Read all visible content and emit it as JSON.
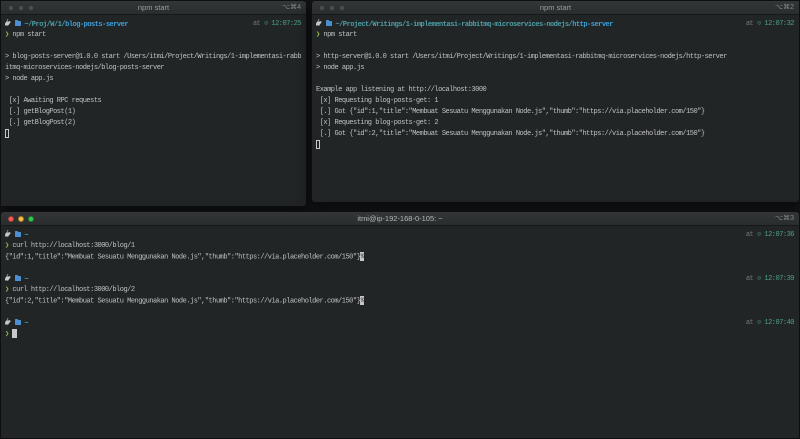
{
  "ui": {
    "at_label": "at ",
    "clock_glyph": "⊙ ",
    "colors": {
      "terminal_bg": "#222526",
      "accent_green": "#97bf4e",
      "accent_cyan": "#4d9fa8",
      "accent_blue": "#3ca0d9",
      "time_teal": "#4ba188",
      "traffic_red": "#fc5b57",
      "traffic_yellow": "#fdbe41",
      "traffic_green": "#34c84a",
      "traffic_inactive": "#4c4f50"
    }
  },
  "windows": {
    "top_left": {
      "title": "npm start",
      "shortcut": "⌥⌘4",
      "active": false,
      "lines": [
        {
          "p": {
            "path": "~/Proj/W/1/",
            "dir": "blog-posts-server",
            "time": "12:07:25"
          }
        },
        {
          "s": [
            {
              "t": "❯",
              "c": "grn"
            },
            {
              "t": " npm start",
              "c": "fg"
            }
          ]
        },
        {
          "s": []
        },
        {
          "s": [
            {
              "t": "> blog-posts-server@1.0.0 start /Users/itmi/Project/Writings/1-implementasi-rabb",
              "c": "fg"
            }
          ]
        },
        {
          "s": [
            {
              "t": "itmq-microservices-nodejs/blog-posts-server",
              "c": "fg"
            }
          ]
        },
        {
          "s": [
            {
              "t": "> node app.js",
              "c": "fg"
            }
          ]
        },
        {
          "s": []
        },
        {
          "s": [
            {
              "t": " [x] Awaiting RPC requests",
              "c": "fg"
            }
          ]
        },
        {
          "s": [
            {
              "t": " [.] getBlogPost(1)",
              "c": "fg"
            }
          ]
        },
        {
          "s": [
            {
              "t": " [.] getBlogPost(2)",
              "c": "fg"
            }
          ]
        },
        {
          "s": [
            {
              "c": "cur_h"
            }
          ]
        }
      ]
    },
    "top_right": {
      "title": "npm start",
      "shortcut": "⌥⌘2",
      "active": false,
      "lines": [
        {
          "p": {
            "path": "~/Project/Writings/1-implementasi-rabbitmq-microservices-nodejs/",
            "dir": "http-server",
            "time": "12:07:32"
          }
        },
        {
          "s": [
            {
              "t": "❯",
              "c": "grn"
            },
            {
              "t": " npm start",
              "c": "fg"
            }
          ]
        },
        {
          "s": []
        },
        {
          "s": [
            {
              "t": "> http-server@1.0.0 start /Users/itmi/Project/Writings/1-implementasi-rabbitmq-microservices-nodejs/http-server",
              "c": "fg"
            }
          ]
        },
        {
          "s": [
            {
              "t": "> node app.js",
              "c": "fg"
            }
          ]
        },
        {
          "s": []
        },
        {
          "s": [
            {
              "t": "Example app listening at http://localhost:3000",
              "c": "fg"
            }
          ]
        },
        {
          "s": [
            {
              "t": " [x] Requesting blog-posts-get: 1",
              "c": "fg"
            }
          ]
        },
        {
          "s": [
            {
              "t": " [.] Got {\"id\":1,\"title\":\"Membuat Sesuatu Menggunakan Node.js\",\"thumb\":\"https://via.placeholder.com/150\"}",
              "c": "fg"
            }
          ]
        },
        {
          "s": [
            {
              "t": " [x] Requesting blog-posts-get: 2",
              "c": "fg"
            }
          ]
        },
        {
          "s": [
            {
              "t": " [.] Got {\"id\":2,\"title\":\"Membuat Sesuatu Menggunakan Node.js\",\"thumb\":\"https://via.placeholder.com/150\"}",
              "c": "fg"
            }
          ]
        },
        {
          "s": [
            {
              "c": "cur_h"
            }
          ]
        }
      ]
    },
    "bottom": {
      "title": "itmi@ip-192-168-0-105: ~",
      "shortcut": "⌥⌘3",
      "active": true,
      "lines": [
        {
          "p": {
            "path": "~",
            "dir": "",
            "time": "12:07:36"
          }
        },
        {
          "s": [
            {
              "t": "❯",
              "c": "grn"
            },
            {
              "t": " curl http://localhost:3000/blog/1",
              "c": "fg"
            }
          ]
        },
        {
          "s": [
            {
              "t": "{\"id\":1,\"title\":\"Membuat Sesuatu Menggunakan Node.js\",\"thumb\":\"https://via.placeholder.com/150\"}",
              "c": "fg"
            },
            {
              "t": "%",
              "c": "inv"
            }
          ]
        },
        {
          "s": []
        },
        {
          "p": {
            "path": "~",
            "dir": "",
            "time": "12:07:39"
          }
        },
        {
          "s": [
            {
              "t": "❯",
              "c": "grn"
            },
            {
              "t": " curl http://localhost:3000/blog/2",
              "c": "fg"
            }
          ]
        },
        {
          "s": [
            {
              "t": "{\"id\":2,\"title\":\"Membuat Sesuatu Menggunakan Node.js\",\"thumb\":\"https://via.placeholder.com/150\"}",
              "c": "fg"
            },
            {
              "t": "%",
              "c": "inv"
            }
          ]
        },
        {
          "s": []
        },
        {
          "p": {
            "path": "~",
            "dir": "",
            "time": "12:07:40"
          }
        },
        {
          "s": [
            {
              "t": "❯ ",
              "c": "grn"
            },
            {
              "c": "cur_s"
            }
          ]
        }
      ]
    }
  }
}
